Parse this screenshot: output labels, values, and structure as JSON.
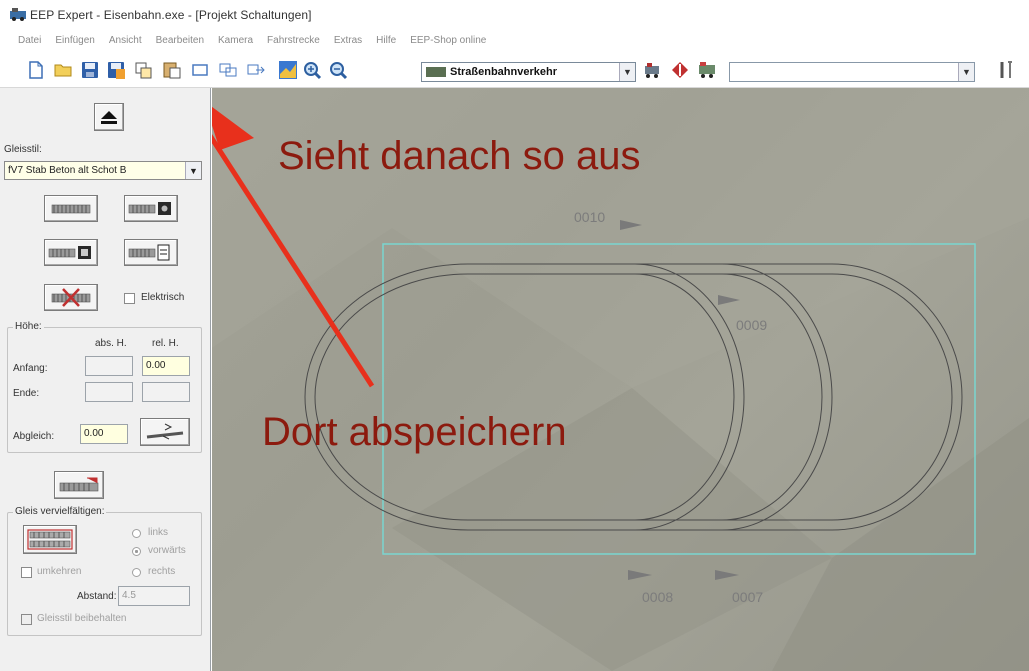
{
  "window": {
    "title": "EEP Expert - Eisenbahn.exe - [Projekt Schaltungen]"
  },
  "menu": {
    "items": [
      "Datei",
      "Einfügen",
      "Ansicht",
      "Bearbeiten",
      "Kamera",
      "Fahrstrecke",
      "Extras",
      "Hilfe",
      "EEP-Shop online"
    ]
  },
  "toolbar": {
    "track_system": "Straßenbahnverkehr",
    "search_value": "",
    "icons": [
      "new-file-icon",
      "open-folder-icon",
      "save-icon",
      "save-as-icon",
      "copy-icon",
      "paste-icon",
      "select-rect-icon",
      "duplicate-icon",
      "move-icon",
      "map-icon",
      "zoom-in-icon",
      "zoom-out-icon",
      "train-icon",
      "signal-icon",
      "goods-wagon-icon",
      "tools-icon"
    ]
  },
  "sidebar": {
    "gleisstil_label": "Gleisstil:",
    "gleisstil_value": "fV7 Stab Beton alt Schot B",
    "elektrisch_label": "Elektrisch",
    "hoehe_title": "Höhe:",
    "abs_h_label": "abs. H.",
    "rel_h_label": "rel. H.",
    "anfang_label": "Anfang:",
    "anfang_abs": "",
    "anfang_rel": "0.00",
    "ende_label": "Ende:",
    "ende_abs": "",
    "ende_rel": "",
    "abgleich_label": "Abgleich:",
    "abgleich_value": "0.00",
    "vervielf_title": "Gleis vervielfältigen:",
    "links_label": "links",
    "vorwaerts_label": "vorwärts",
    "umkehren_label": "umkehren",
    "rechts_label": "rechts",
    "abstand_label": "Abstand:",
    "abstand_value": "4.5",
    "beibehalten_label": "Gleisstil beibehalten"
  },
  "viewport": {
    "annotation_top": "Sieht danach so aus",
    "annotation_bottom": "Dort abspeichern",
    "track_labels": [
      "0010",
      "0009",
      "0008",
      "0007"
    ],
    "annotation_color": "#8c1a0e",
    "arrow_color": "#e8301c",
    "selection_color": "#7ad6d0"
  }
}
